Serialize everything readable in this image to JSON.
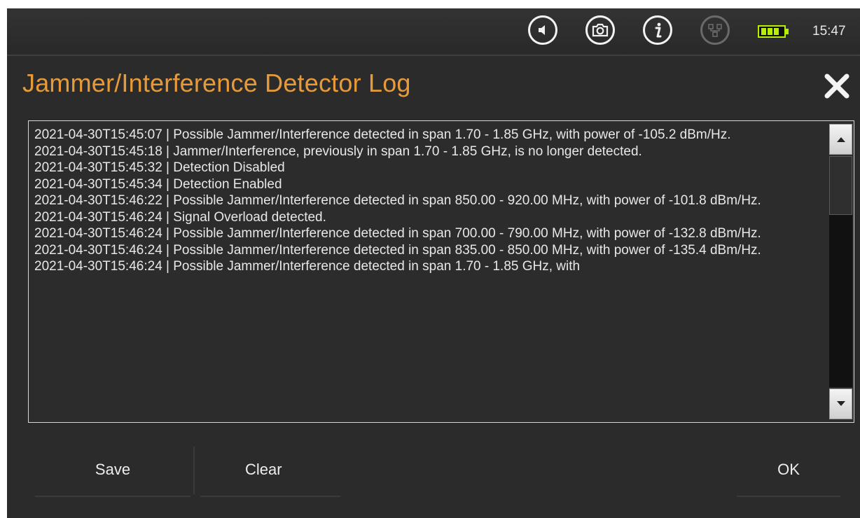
{
  "status_bar": {
    "icons": [
      "speaker-icon",
      "camera-icon",
      "info-icon",
      "network-icon",
      "battery-icon"
    ],
    "clock": "15:47"
  },
  "dialog": {
    "title": "Jammer/Interference Detector Log",
    "close_icon": "close-icon"
  },
  "log": {
    "entries": [
      "2021-04-30T15:45:07 | Possible Jammer/Interference detected in span 1.70 - 1.85 GHz, with power of -105.2 dBm/Hz.",
      "2021-04-30T15:45:18 | Jammer/Interference, previously in span 1.70 - 1.85 GHz, is no longer detected.",
      "2021-04-30T15:45:32 | Detection Disabled",
      "2021-04-30T15:45:34 | Detection Enabled",
      "2021-04-30T15:46:22 | Possible Jammer/Interference detected in span 850.00 - 920.00 MHz, with power of -101.8 dBm/Hz.",
      "2021-04-30T15:46:24 | Signal Overload detected.",
      "2021-04-30T15:46:24 | Possible Jammer/Interference detected in span 700.00 - 790.00 MHz, with power of -132.8 dBm/Hz.",
      "2021-04-30T15:46:24 | Possible Jammer/Interference detected in span 835.00 - 850.00 MHz, with power of -135.4 dBm/Hz.",
      "2021-04-30T15:46:24 | Possible Jammer/Interference detected in span 1.70 - 1.85 GHz, with"
    ]
  },
  "buttons": {
    "save": "Save",
    "clear": "Clear",
    "ok": "OK"
  },
  "colors": {
    "title": "#e69a3a",
    "background": "#2b2b2b",
    "battery": "#b6f000"
  }
}
